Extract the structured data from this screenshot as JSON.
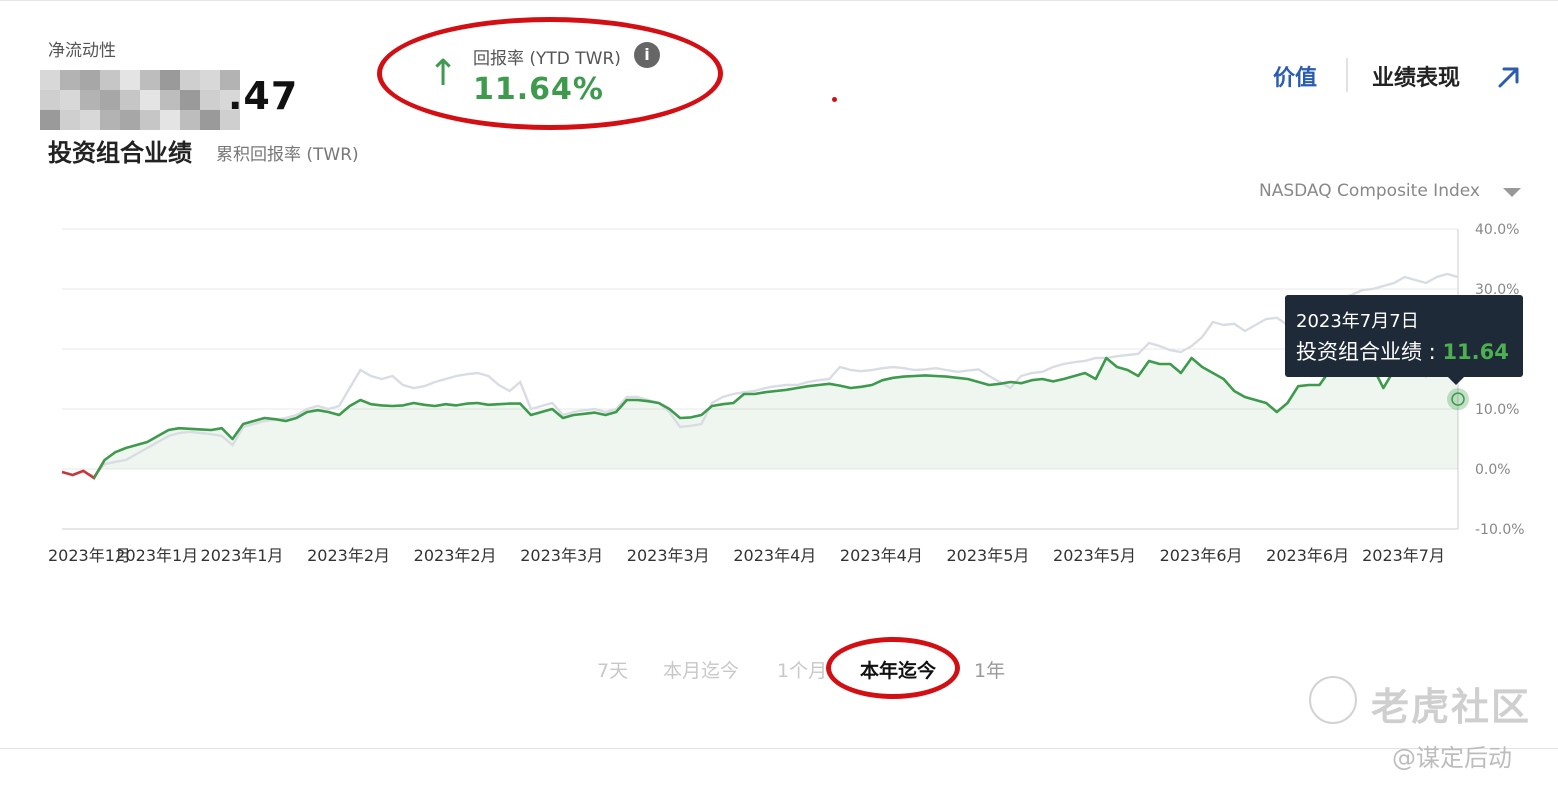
{
  "header": {
    "net_liquidity_label": "净流动性",
    "net_liquidity_value_visible": ".47",
    "title": "投资组合业绩",
    "subtitle": "累积回报率 (TWR)"
  },
  "return": {
    "label": "回报率 (YTD TWR)",
    "value": "11.64%",
    "direction_icon": "arrow-up-icon",
    "info_icon": "info-icon"
  },
  "nav": {
    "value_tab": "价值",
    "performance_tab": "业绩表现",
    "external_icon": "external-link-icon"
  },
  "benchmark": {
    "selected": "NASDAQ Composite Index",
    "dropdown_icon": "caret-down-icon"
  },
  "colors": {
    "portfolio": "#3e9a4c",
    "portfolio_negative": "#c9373c",
    "benchmark": "#d9dde3",
    "accent_blue": "#2a5db0",
    "annotation_red": "#d40f14"
  },
  "chart_data": {
    "type": "line",
    "title": "投资组合业绩",
    "subtitle": "累积回报率 (TWR)",
    "ylabel": "",
    "xlabel": "",
    "ylim": [
      -10,
      40
    ],
    "y_ticks": [
      "40.0%",
      "30.0%",
      "20.0%",
      "10.0%",
      "0.0%",
      "-10.0%"
    ],
    "y_tick_values": [
      40,
      30,
      20,
      10,
      0,
      -10
    ],
    "x_tick_labels": [
      "2023年1月",
      "2023年1月",
      "2023年1月",
      "2023年2月",
      "2023年2月",
      "2023年3月",
      "2023年3月",
      "2023年4月",
      "2023年4月",
      "2023年5月",
      "2023年5月",
      "2023年6月",
      "2023年6月",
      "2023年7月"
    ],
    "x_tick_index": [
      0,
      5,
      13,
      23,
      33,
      43,
      53,
      63,
      73,
      83,
      93,
      103,
      113,
      122
    ],
    "x_count": 132,
    "grid": true,
    "legend": "none",
    "series": [
      {
        "key": "portfolio",
        "label": "投资组合业绩",
        "values": [
          -0.5,
          -1.0,
          -0.3,
          -1.5,
          1.5,
          2.8,
          3.5,
          4.0,
          4.5,
          5.5,
          6.5,
          6.8,
          6.7,
          6.6,
          6.5,
          6.8,
          5.0,
          7.5,
          8.0,
          8.5,
          8.3,
          8.0,
          8.5,
          9.5,
          9.8,
          9.5,
          9.0,
          10.5,
          11.5,
          10.8,
          10.6,
          10.5,
          10.6,
          11.0,
          10.7,
          10.5,
          10.8,
          10.6,
          10.9,
          11.0,
          10.7,
          10.8,
          10.9,
          10.9,
          9.0,
          9.5,
          10.0,
          8.5,
          9.0,
          9.2,
          9.4,
          9.0,
          9.5,
          11.5,
          11.5,
          11.3,
          11.0,
          10.0,
          8.5,
          8.6,
          9.0,
          10.5,
          10.8,
          11.0,
          12.5,
          12.5,
          12.8,
          13.0,
          13.2,
          13.5,
          13.8,
          14.0,
          14.2,
          13.9,
          13.5,
          13.7,
          14.0,
          14.8,
          15.2,
          15.4,
          15.5,
          15.6,
          15.5,
          15.4,
          15.2,
          15.0,
          14.5,
          14.0,
          14.2,
          14.5,
          14.3,
          14.8,
          15.0,
          14.6,
          15.0,
          15.5,
          16.0,
          15.0,
          18.5,
          17.0,
          16.5,
          15.5,
          18.0,
          17.5,
          17.5,
          16.0,
          18.5,
          17.0,
          16.0,
          15.0,
          13.0,
          12.0,
          11.5,
          11.0,
          9.5,
          11.0,
          13.8,
          14.0,
          14.0,
          16.5,
          19.0,
          17.5,
          17.5,
          17.0,
          13.5,
          16.5,
          16.8,
          17.0,
          15.5,
          17.0,
          18.5,
          18.0,
          11.64
        ],
        "note_values_pct": true
      },
      {
        "key": "benchmark",
        "label": "NASDAQ Composite Index",
        "values": [
          -0.5,
          -1.0,
          -0.5,
          -1.2,
          0.8,
          1.2,
          1.5,
          2.5,
          3.5,
          4.5,
          5.5,
          6.0,
          6.2,
          6.0,
          5.8,
          5.5,
          4.0,
          7.0,
          7.5,
          8.0,
          8.2,
          8.5,
          9.0,
          10.0,
          10.5,
          10.0,
          10.5,
          13.5,
          16.5,
          15.5,
          15.0,
          15.5,
          14.0,
          13.5,
          13.8,
          14.5,
          15.0,
          15.5,
          15.8,
          16.0,
          15.5,
          14.0,
          13.0,
          14.5,
          10.0,
          10.5,
          11.0,
          9.0,
          9.5,
          9.8,
          10.0,
          9.5,
          10.0,
          12.0,
          12.0,
          11.5,
          11.0,
          9.5,
          7.0,
          7.2,
          7.5,
          11.0,
          12.0,
          12.5,
          12.8,
          13.0,
          13.5,
          13.8,
          14.0,
          14.0,
          14.5,
          14.8,
          15.0,
          17.0,
          16.5,
          16.3,
          16.5,
          16.8,
          17.0,
          16.8,
          16.5,
          16.6,
          16.8,
          16.5,
          16.2,
          16.4,
          16.6,
          15.5,
          14.5,
          13.5,
          15.5,
          16.0,
          16.2,
          17.0,
          17.5,
          17.8,
          18.0,
          18.5,
          18.5,
          18.8,
          19.0,
          19.2,
          21.0,
          20.5,
          19.8,
          19.5,
          20.5,
          22.0,
          24.5,
          24.0,
          24.2,
          23.0,
          24.0,
          25.0,
          25.2,
          24.0,
          24.5,
          26.5,
          27.0,
          28.0,
          28.5,
          29.0,
          29.8,
          30.0,
          30.5,
          31.0,
          32.0,
          31.5,
          31.0,
          32.0,
          32.5,
          32.0
        ]
      }
    ],
    "tooltip": {
      "date": "2023年7月7日",
      "series_label": "投资组合业绩 :",
      "value": "11.64",
      "index": 131
    }
  },
  "range": {
    "items": [
      "7天",
      "本月迄今",
      "1个月",
      "本年迄今",
      "1年"
    ],
    "active": "本年迄今"
  },
  "watermark": {
    "brand": "老虎社区",
    "handle": "@谋定后动"
  }
}
